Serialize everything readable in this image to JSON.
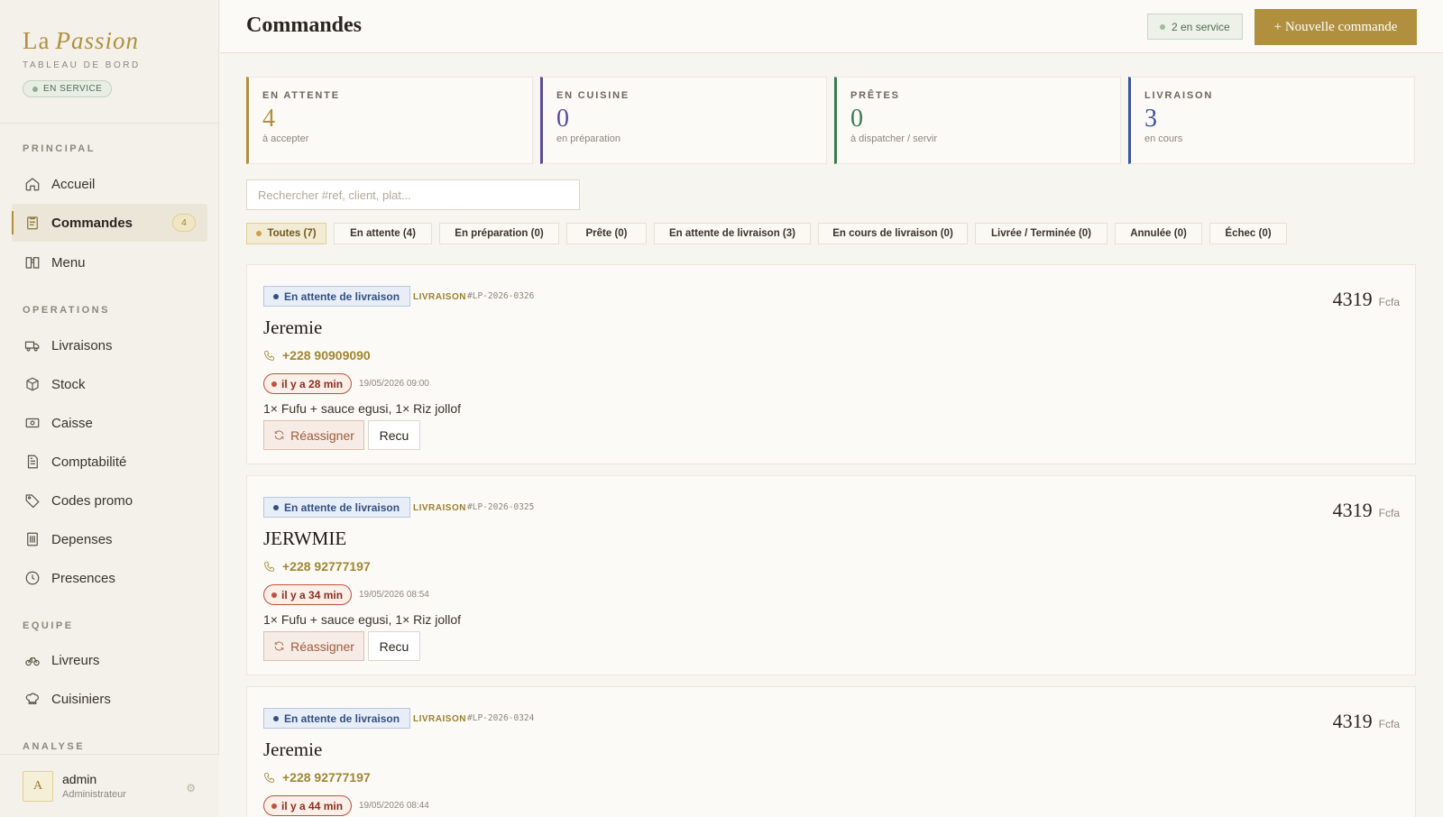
{
  "brand": {
    "name_plain": "La",
    "name_italic": "Passion",
    "subtitle": "TABLEAU DE BORD",
    "status": "EN SERVICE"
  },
  "sidebar": {
    "sections": {
      "principal": "PRINCIPAL",
      "operations": "OPERATIONS",
      "equipe": "EQUIPE",
      "analyse": "ANALYSE"
    },
    "items": {
      "accueil": "Accueil",
      "commandes": "Commandes",
      "commandes_badge": "4",
      "menu": "Menu",
      "livraisons": "Livraisons",
      "stock": "Stock",
      "caisse": "Caisse",
      "comptabilite": "Comptabilité",
      "codes_promo": "Codes promo",
      "depenses": "Depenses",
      "presences": "Presences",
      "livreurs": "Livreurs",
      "cuisiniers": "Cuisiniers"
    },
    "user": {
      "initial": "A",
      "name": "admin",
      "role": "Administrateur"
    }
  },
  "header": {
    "title": "Commandes",
    "service_chip": "2 en service",
    "new_order": "+ Nouvelle commande"
  },
  "stats": [
    {
      "label": "EN ATTENTE",
      "value": "4",
      "sub": "à accepter",
      "color": "#b0903e"
    },
    {
      "label": "EN CUISINE",
      "value": "0",
      "sub": "en préparation",
      "color": "#5b4a9a"
    },
    {
      "label": "PRÊTES",
      "value": "0",
      "sub": "à dispatcher / servir",
      "color": "#3d7a4f"
    },
    {
      "label": "LIVRAISON",
      "value": "3",
      "sub": "en cours",
      "color": "#3b55a0"
    }
  ],
  "search": {
    "placeholder": "Rechercher #ref, client, plat..."
  },
  "filters": [
    "Toutes (7)",
    "En attente (4)",
    "En préparation (0)",
    "Prête (0)",
    "En attente de livraison (3)",
    "En cours de livraison (0)",
    "Livrée / Terminée (0)",
    "Annulée (0)",
    "Échec (0)"
  ],
  "orders": [
    {
      "status": "En attente de livraison",
      "type": "LIVRAISON",
      "ref": "#LP-2026-0326",
      "amount": "4319",
      "currency": "Fcfa",
      "client": "Jeremie",
      "phone": "+228 90909090",
      "elapsed": "il y a 28 min",
      "date": "19/05/2026 09:00",
      "items": "1× Fufu + sauce egusi, 1× Riz jollof",
      "btn_reassign": "Réassigner",
      "btn_recu": "Recu"
    },
    {
      "status": "En attente de livraison",
      "type": "LIVRAISON",
      "ref": "#LP-2026-0325",
      "amount": "4319",
      "currency": "Fcfa",
      "client": "JERWMIE",
      "phone": "+228 92777197",
      "elapsed": "il y a 34 min",
      "date": "19/05/2026 08:54",
      "items": "1× Fufu + sauce egusi, 1× Riz jollof",
      "btn_reassign": "Réassigner",
      "btn_recu": "Recu"
    },
    {
      "status": "En attente de livraison",
      "type": "LIVRAISON",
      "ref": "#LP-2026-0324",
      "amount": "4319",
      "currency": "Fcfa",
      "client": "Jeremie",
      "phone": "+228 92777197",
      "elapsed": "il y a 44 min",
      "date": "19/05/2026 08:44"
    }
  ],
  "colors": {
    "accent": "#b0903e",
    "status_blue": "#334f83",
    "alert_red": "#c0513c",
    "service_green": "#4f6c52"
  }
}
